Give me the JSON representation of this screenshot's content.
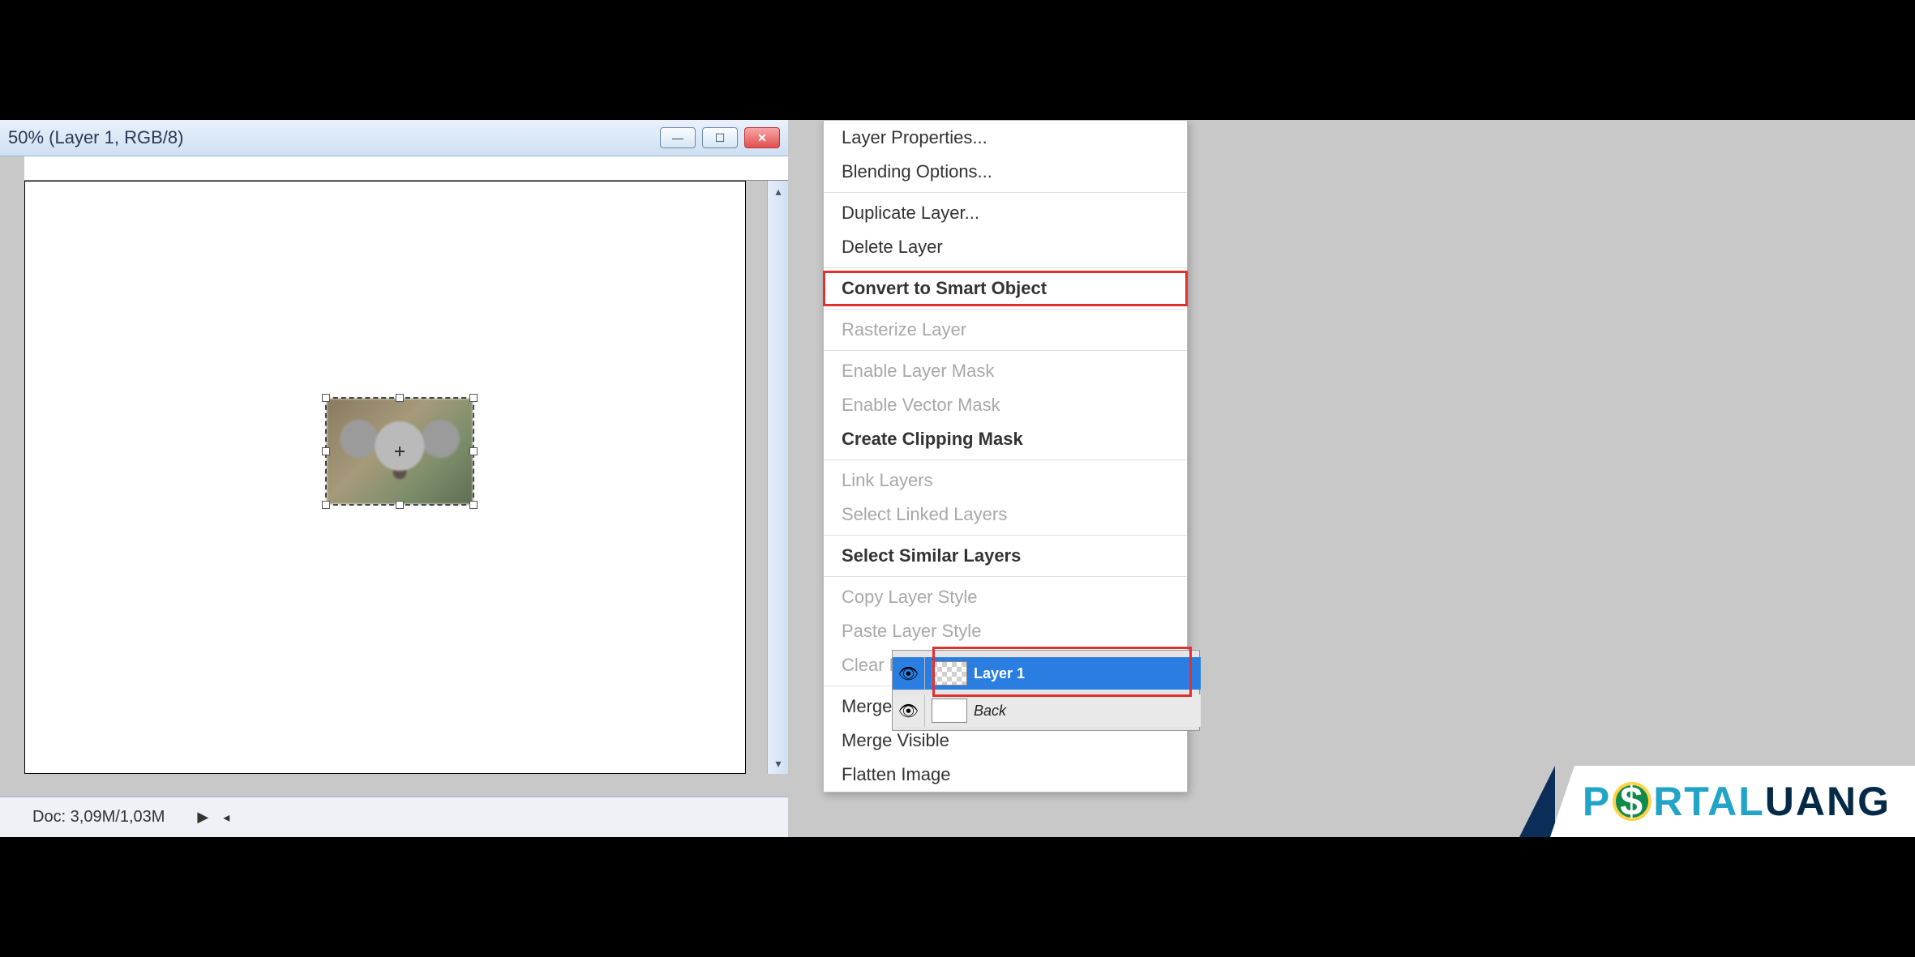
{
  "window": {
    "title_suffix": " 50% (Layer 1, RGB/8)"
  },
  "status": {
    "doc_size": "Doc: 3,09M/1,03M"
  },
  "context_menu": {
    "items": [
      {
        "label": "Layer Properties...",
        "enabled": true,
        "highlight": false
      },
      {
        "label": "Blending Options...",
        "enabled": true,
        "highlight": false
      },
      {
        "sep": true
      },
      {
        "label": "Duplicate Layer...",
        "enabled": true,
        "highlight": false
      },
      {
        "label": "Delete Layer",
        "enabled": true,
        "highlight": false
      },
      {
        "sep": true
      },
      {
        "label": "Convert to Smart Object",
        "enabled": true,
        "highlight": true,
        "bold": true
      },
      {
        "sep": true
      },
      {
        "label": "Rasterize Layer",
        "enabled": false,
        "highlight": false
      },
      {
        "sep": true
      },
      {
        "label": "Enable Layer Mask",
        "enabled": false,
        "highlight": false
      },
      {
        "label": "Enable Vector Mask",
        "enabled": false,
        "highlight": false
      },
      {
        "label": "Create Clipping Mask",
        "enabled": true,
        "highlight": false,
        "bold": true
      },
      {
        "sep": true
      },
      {
        "label": "Link Layers",
        "enabled": false,
        "highlight": false
      },
      {
        "label": "Select Linked Layers",
        "enabled": false,
        "highlight": false
      },
      {
        "sep": true
      },
      {
        "label": "Select Similar Layers",
        "enabled": true,
        "highlight": false,
        "bold": true
      },
      {
        "sep": true
      },
      {
        "label": "Copy Layer Style",
        "enabled": false,
        "highlight": false
      },
      {
        "label": "Paste Layer Style",
        "enabled": false,
        "highlight": false
      },
      {
        "label": "Clear Layer Style",
        "enabled": false,
        "highlight": false
      },
      {
        "sep": true
      },
      {
        "label": "Merge Down",
        "enabled": true,
        "highlight": false
      },
      {
        "label": "Merge Visible",
        "enabled": true,
        "highlight": false
      },
      {
        "label": "Flatten Image",
        "enabled": true,
        "highlight": false
      }
    ]
  },
  "layers": {
    "selected": {
      "name": "Layer 1"
    },
    "background": {
      "name": "Back"
    }
  },
  "watermark": {
    "part1": "P",
    "coin": "$",
    "part2": "RTAL",
    "part3": "UANG"
  }
}
